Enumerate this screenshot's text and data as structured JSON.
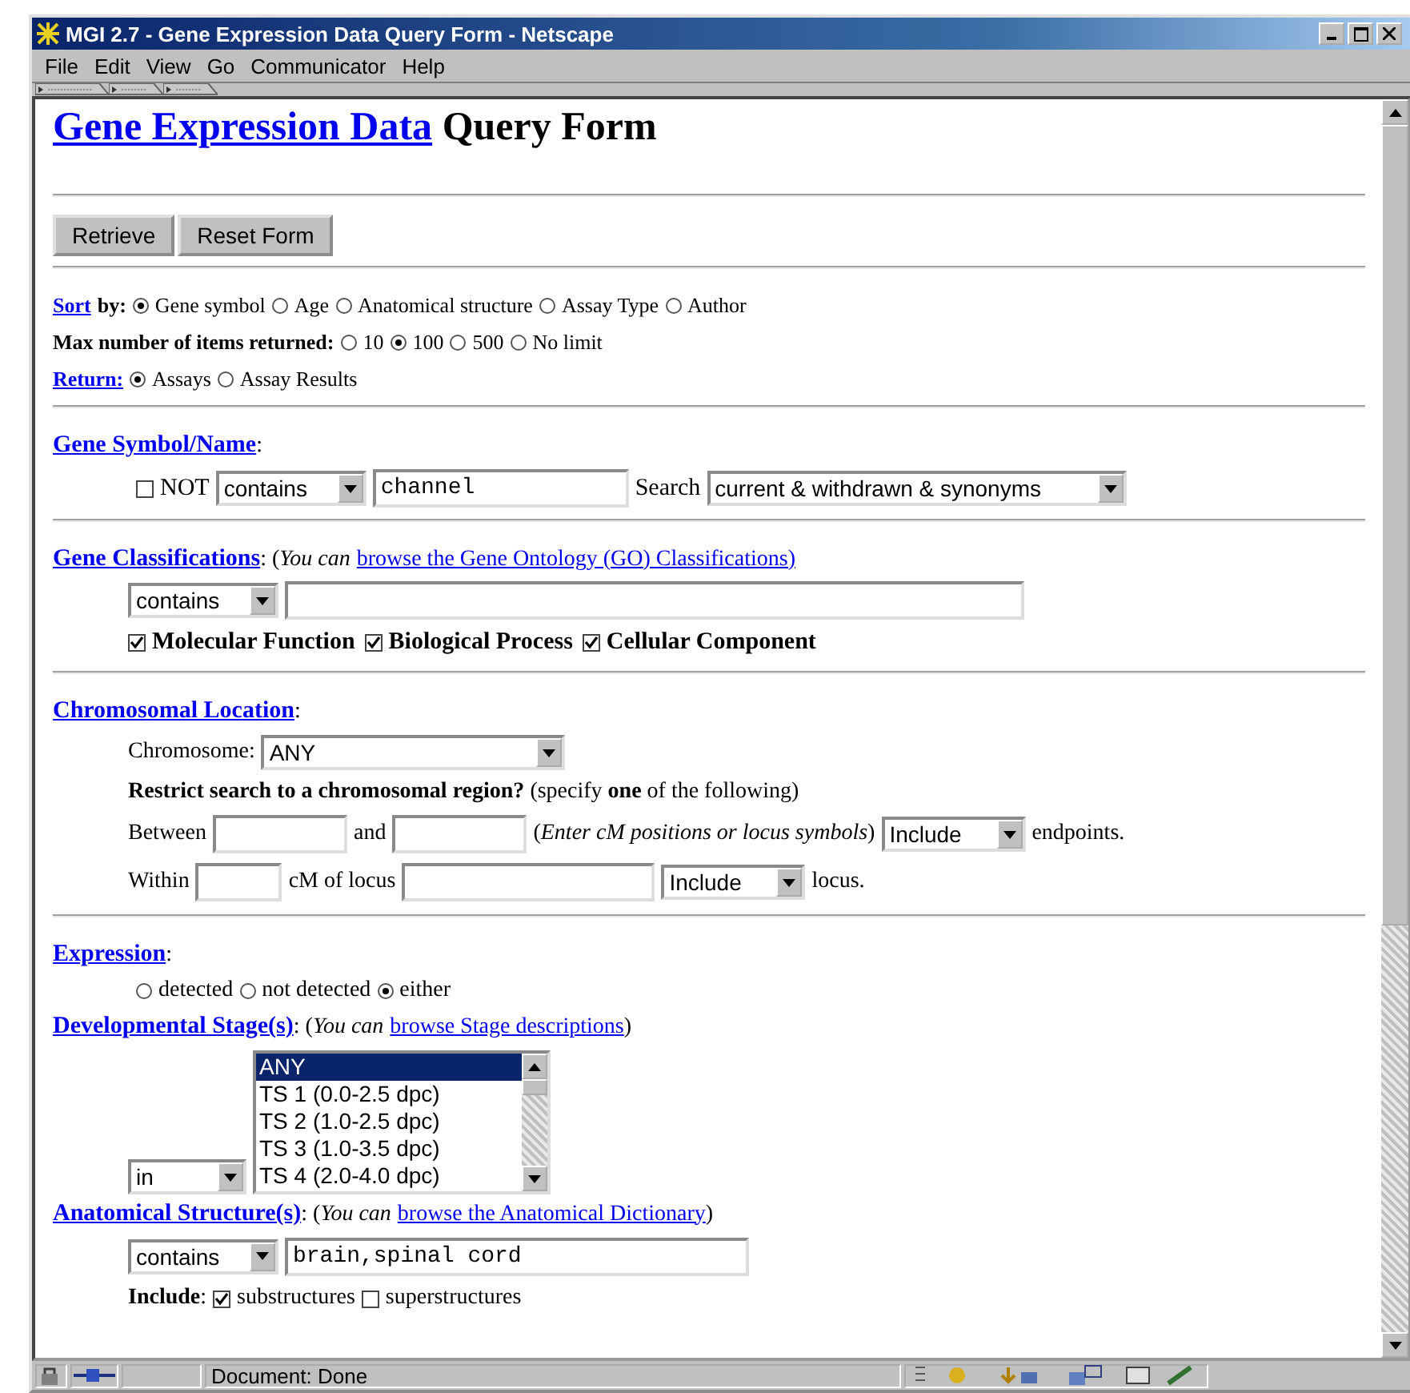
{
  "window": {
    "title": "MGI 2.7 - Gene Expression Data Query Form - Netscape"
  },
  "menu": [
    "File",
    "Edit",
    "View",
    "Go",
    "Communicator",
    "Help"
  ],
  "heading": {
    "link": "Gene Expression Data",
    "text": "Query Form"
  },
  "buttons": [
    "Retrieve",
    "Reset Form"
  ],
  "options_rows": [
    {
      "link": "Sort",
      "label": "by:",
      "options": [
        {
          "label": "Gene symbol",
          "selected": true
        },
        {
          "label": "Age",
          "selected": false
        },
        {
          "label": "Anatomical structure",
          "selected": false
        },
        {
          "label": "Assay Type",
          "selected": false
        },
        {
          "label": "Author",
          "selected": false
        }
      ]
    },
    {
      "label": "Max number of items returned:",
      "options": [
        {
          "label": "10",
          "selected": false
        },
        {
          "label": "100",
          "selected": true
        },
        {
          "label": "500",
          "selected": false
        },
        {
          "label": "No limit",
          "selected": false
        }
      ]
    },
    {
      "link": "Return:",
      "options": [
        {
          "label": "Assays",
          "selected": true
        },
        {
          "label": "Assay Results",
          "selected": false
        }
      ]
    }
  ],
  "gene_symbol": {
    "link": "Gene Symbol/Name",
    "after": ":",
    "not": {
      "label": "NOT",
      "checked": false
    },
    "operator": "contains",
    "value": "channel",
    "search_label": "Search",
    "search": "current & withdrawn & synonyms"
  },
  "gene_classifications": {
    "link": "Gene Classifications",
    "note": ": (*You can* ",
    "note_link": "browse the Gene Ontology (GO) Classifications)",
    "operator": "contains",
    "checkboxes": [
      {
        "label": "Molecular Function",
        "checked": true
      },
      {
        "label": "Biological Process",
        "checked": true
      },
      {
        "label": "Cellular Component",
        "checked": true
      }
    ]
  },
  "chromosomal_location": {
    "link": "Chromosomal Location",
    "after": ":",
    "chromosome_label": "Chromosome:",
    "chromosome": "ANY",
    "restrict": "**Restrict search to a chromosomal region?** (specify **one** of the following)",
    "between": {
      "label": "Between",
      "and": "and",
      "note": "(*Enter cM positions or locus symbols*)",
      "select": "Include",
      "after": "endpoints."
    },
    "within": {
      "label": "Within",
      "of": "cM of locus",
      "select": "Include",
      "after": "locus."
    }
  },
  "expression": {
    "link": "Expression",
    "after": ":",
    "options": [
      {
        "label": "detected",
        "selected": false
      },
      {
        "label": "not detected",
        "selected": false
      },
      {
        "label": "either",
        "selected": true
      }
    ]
  },
  "developmental_stage": {
    "link": "Developmental Stage(s)",
    "note": ": (*You can* ",
    "note_link": "browse Stage descriptions",
    "after": ")",
    "operator": "in",
    "items": [
      {
        "label": "ANY",
        "selected": true
      },
      {
        "label": "TS 1 (0.0-2.5 dpc)",
        "selected": false
      },
      {
        "label": "TS 2 (1.0-2.5 dpc)",
        "selected": false
      },
      {
        "label": "TS 3 (1.0-3.5 dpc)",
        "selected": false
      },
      {
        "label": "TS 4 (2.0-4.0 dpc)",
        "selected": false
      }
    ]
  },
  "anatomical_structure": {
    "link": "Anatomical Structure(s)",
    "note": ": (*You can* ",
    "note_link": "browse the Anatomical Dictionary",
    "after": ")",
    "operator": "contains",
    "value": "brain,spinal cord",
    "include_label": "**Include**:",
    "checkboxes": [
      {
        "label": "substructures",
        "checked": true
      },
      {
        "label": "superstructures",
        "checked": false
      }
    ]
  },
  "status_bar": {
    "text": "Document: Done"
  }
}
